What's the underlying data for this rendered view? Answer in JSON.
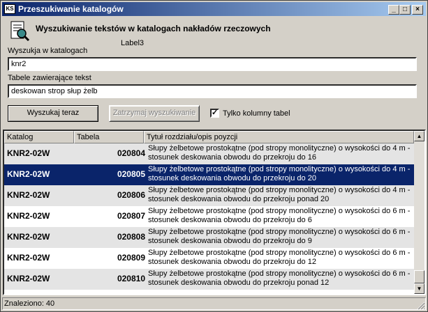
{
  "window": {
    "title": "Przeszukiwanie katalogów",
    "icon_text": "KS",
    "buttons": {
      "minimize": "_",
      "maximize": "□",
      "close": "×"
    }
  },
  "header": {
    "title": "Wyszukiwanie tekstów w katalogach nakładów rzeczowych",
    "label3": "Label3"
  },
  "catalogs": {
    "label": "Wyszukja w katalogach",
    "value": "knr2"
  },
  "tables": {
    "label": "Tabele zawierające tekst",
    "value": "deskowan strop słup żelb"
  },
  "actions": {
    "search_label": "Wyszukaj teraz",
    "stop_label": "Zatrzymaj wyszukiwanie",
    "only_columns_label": "Tylko kolumny tabel",
    "only_columns_checked": true
  },
  "results": {
    "columns": [
      "Katalog",
      "Tabela",
      "Tytuł rozdziału/opis poyzcji"
    ],
    "rows": [
      {
        "katalog": "KNR2-02W",
        "tabela": "020804",
        "desc": "Słupy żelbetowe prostokątne (pod stropy monolityczne) o wysokości do 4 m - stosunek deskowania obwodu do przekroju do 16"
      },
      {
        "katalog": "KNR2-02W",
        "tabela": "020805",
        "desc": "Słupy żelbetowe prostokątne (pod stropy monolityczne) o wysokości do 4 m - stosunek deskowania obwodu do przekroju do 20"
      },
      {
        "katalog": "KNR2-02W",
        "tabela": "020806",
        "desc": "Słupy żelbetowe prostokątne (pod stropy monolityczne) o wysokości do 4 m - stosunek deskowania obwodu do przekroju ponad 20"
      },
      {
        "katalog": "KNR2-02W",
        "tabela": "020807",
        "desc": "Słupy żelbetowe prostokątne (pod stropy monolityczne) o wysokości do 6 m - stosunek deskowania obwodu do przekroju do 6"
      },
      {
        "katalog": "KNR2-02W",
        "tabela": "020808",
        "desc": "Słupy żelbetowe prostokątne (pod stropy monolityczne) o wysokości do 6 m - stosunek deskowania obwodu do przekroju do 9"
      },
      {
        "katalog": "KNR2-02W",
        "tabela": "020809",
        "desc": "Słupy żelbetowe prostokątne (pod stropy monolityczne) o wysokości do 6 m - stosunek deskowania obwodu do przekroju do 12"
      },
      {
        "katalog": "KNR2-02W",
        "tabela": "020810",
        "desc": "Słupy żelbetowe prostokątne (pod stropy monolityczne) o wysokości do 6 m - stosunek deskowania obwodu do przekroju ponad 12"
      }
    ],
    "selected_index": 1
  },
  "status": {
    "found_text": "Znaleziono: 40"
  },
  "colors": {
    "title_start": "#0a246a",
    "title_end": "#a6caf0",
    "selection": "#0a246a",
    "face": "#d4d0c8"
  }
}
